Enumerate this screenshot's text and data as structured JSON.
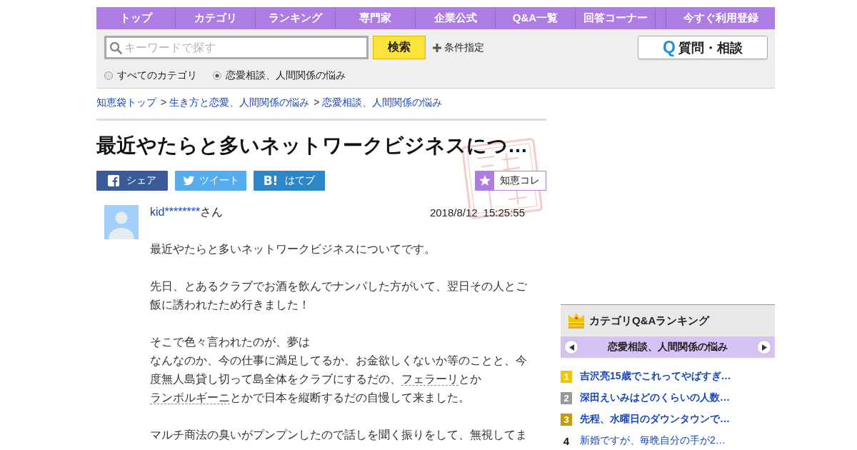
{
  "nav": {
    "items": [
      {
        "label": "トップ",
        "kind": "link"
      },
      {
        "label": "カテゴリ",
        "kind": "link"
      },
      {
        "label": "ランキング",
        "kind": "link"
      },
      {
        "label": "専門家",
        "kind": "link"
      },
      {
        "label": "企業公式",
        "kind": "link"
      },
      {
        "label": "Q&A一覧",
        "kind": "link"
      },
      {
        "label": "回答コーナー",
        "kind": "link"
      },
      {
        "label": "今すぐ利用登録",
        "kind": "register"
      }
    ]
  },
  "search": {
    "placeholder": "キーワードで探す",
    "button": "検索",
    "conditions": "条件指定",
    "scopes": [
      {
        "label": "すべてのカテゴリ",
        "selected": false
      },
      {
        "label": "恋愛相談、人間関係の悩み",
        "selected": true
      }
    ]
  },
  "ask_button": {
    "mark": "Q",
    "label": "質問・相談"
  },
  "breadcrumb": [
    {
      "text": "知恵袋トップ"
    },
    {
      "prefix": ">",
      "text": "生き方と恋愛、人間関係の悩み"
    },
    {
      "prefix": ">",
      "text": "恋愛相談、人間関係の悩み"
    }
  ],
  "question": {
    "title": "最近やたらと多いネットワークビジネスにつ…",
    "resolved": true,
    "share": [
      {
        "kind": "facebook",
        "label": "シェア"
      },
      {
        "kind": "twitter",
        "label": "ツイート"
      },
      {
        "kind": "hatena",
        "mark": "B!",
        "label": "はてブ"
      }
    ],
    "collect": {
      "label": "知恵コレ"
    },
    "author": {
      "name": "kid********",
      "suffix": "さん"
    },
    "date": "2018/8/12",
    "time": "15:25:55",
    "body": [
      [
        [
          {
            "kind": "text",
            "text": "最近やたらと多いネットワークビジネスについてです。"
          }
        ]
      ],
      [
        [
          {
            "kind": "text",
            "text": "先日、とあるクラブでお酒を飲んでナンパした方がいて、翌日その人とご飯に誘われたため行きました！"
          }
        ]
      ],
      [
        [
          {
            "kind": "text",
            "text": "そこで色々言われたのが、夢は"
          }
        ],
        [
          {
            "kind": "text",
            "text": "なんなのか、今の仕事に満足してるか、お金欲しくないか等のことと、今度無人島貸し切って島全体をクラブにするだの、"
          },
          {
            "kind": "keyword",
            "text": "フェラーリ"
          },
          {
            "kind": "text",
            "text": "とか"
          },
          {
            "kind": "keyword",
            "text": "ランボルギーニ"
          },
          {
            "kind": "text",
            "text": "とかで日本を縦断するだの自慢して来ました。"
          }
        ]
      ],
      [
        [
          {
            "kind": "text",
            "text": "マルチ商法の臭いがプンプンしたので話しを聞く振りをして、無視してま"
          }
        ]
      ]
    ]
  },
  "ranking": {
    "title": "カテゴリQ&Aランキング",
    "category": "恋愛相談、人間関係の悩み",
    "items": [
      {
        "rank": "1",
        "title": "吉沢亮15歳でこれってやばすぎ…",
        "kind": "badge",
        "color": "#f5c400"
      },
      {
        "rank": "2",
        "title": "深田えいみはどのくらいの人数…",
        "kind": "badge",
        "color": "#999999"
      },
      {
        "rank": "3",
        "title": "先程、水曜日のダウンタウンで…",
        "kind": "badge",
        "color": "#c99a06"
      },
      {
        "rank": "4",
        "title": "新婚ですが、毎晩自分の手が2…",
        "kind": "plain"
      }
    ]
  }
}
